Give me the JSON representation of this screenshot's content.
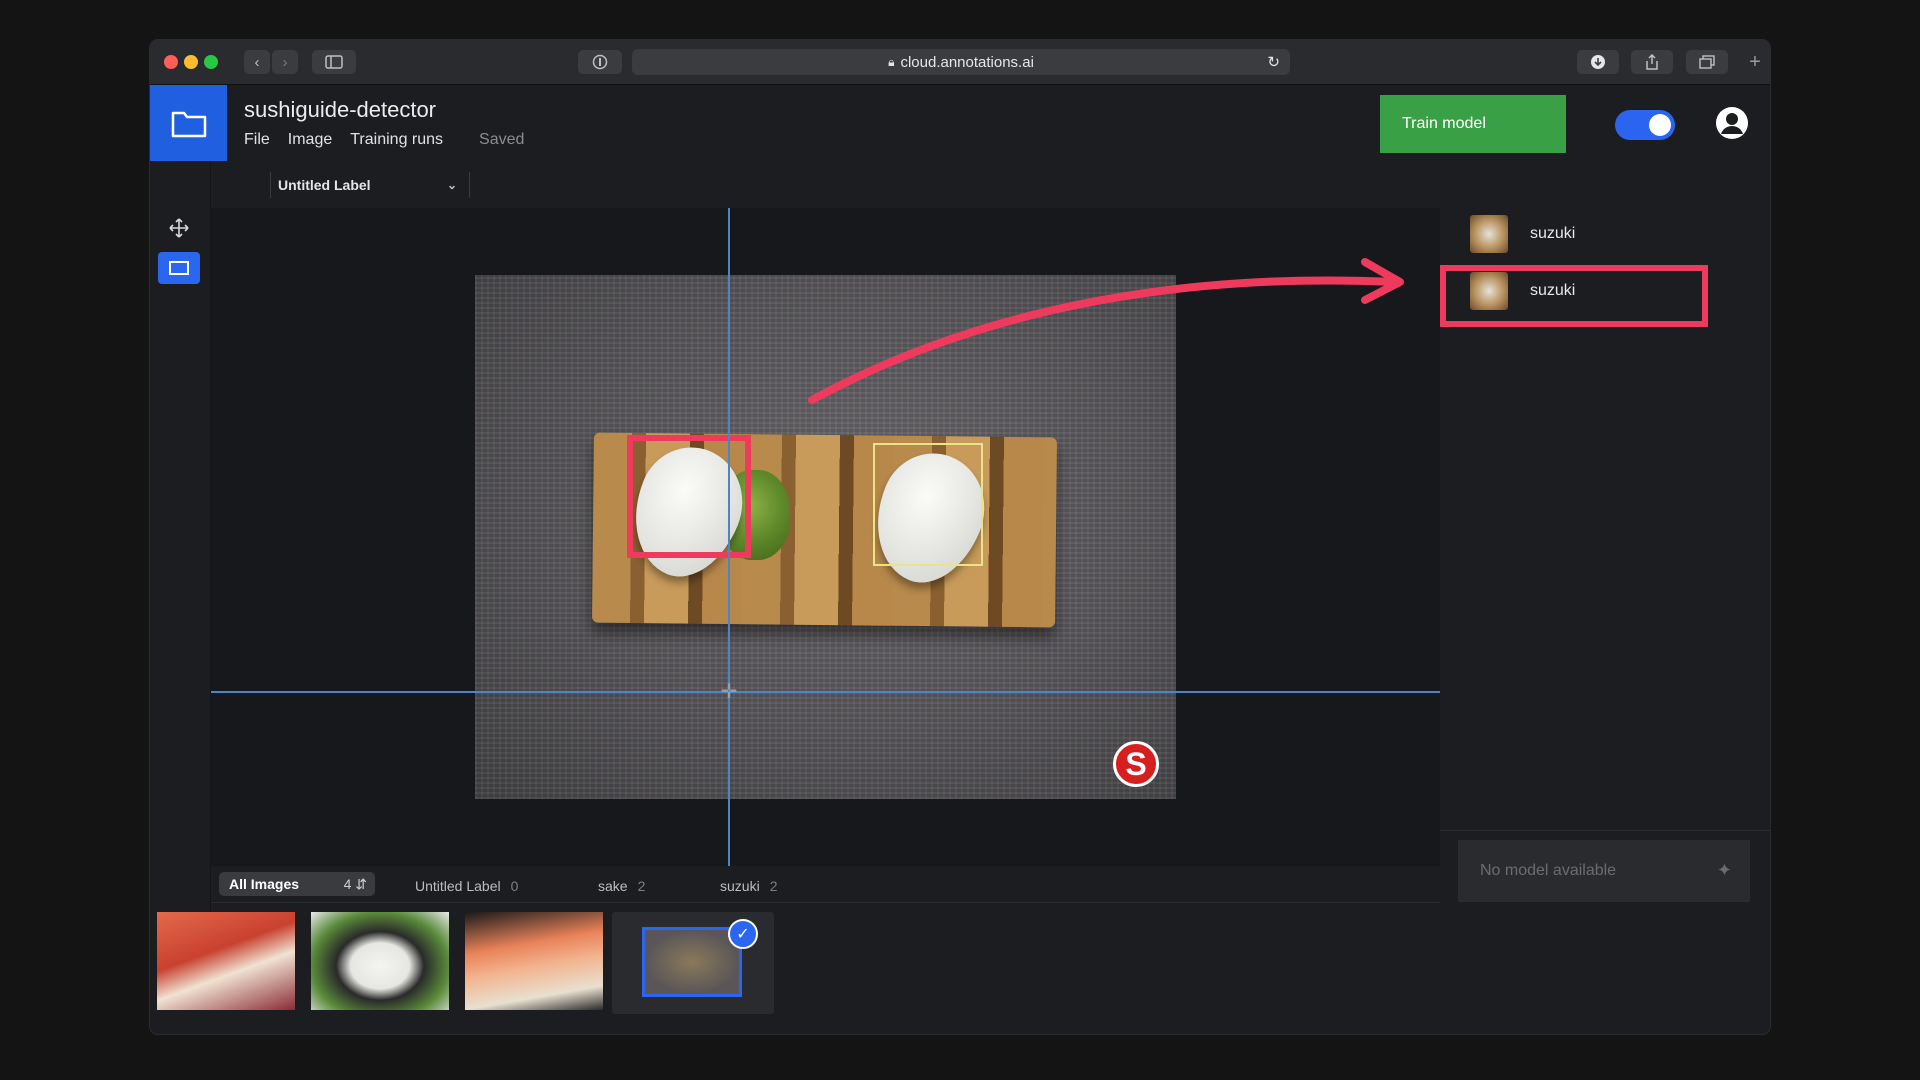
{
  "browser": {
    "url": "cloud.annotations.ai"
  },
  "header": {
    "project_title": "sushiguide-detector",
    "menu": [
      "File",
      "Image",
      "Training runs"
    ],
    "status": "Saved",
    "train_button": "Train model",
    "toggle_on": true
  },
  "label_selector": {
    "value": "Untitled Label"
  },
  "annotations": [
    {
      "label": "suzuki"
    },
    {
      "label": "suzuki"
    }
  ],
  "model_panel": {
    "placeholder": "No model available"
  },
  "filters": {
    "all": {
      "label": "All Images",
      "count": "4"
    },
    "labels": [
      {
        "name": "Untitled Label",
        "count": "0"
      },
      {
        "name": "sake",
        "count": "2"
      },
      {
        "name": "suzuki",
        "count": "2"
      }
    ]
  },
  "image_overlay": {
    "logo_letter": "S"
  },
  "colors": {
    "accent": "#1f5fe0",
    "train": "#3aa046",
    "highlight": "#ee3a5c",
    "bbox": "#e9e38a",
    "crosshair": "#4a86c7"
  }
}
